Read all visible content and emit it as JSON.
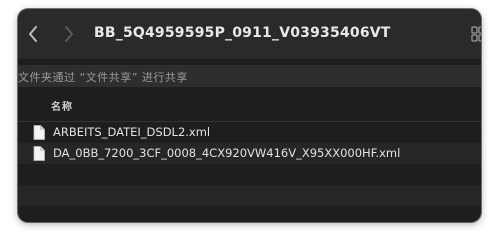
{
  "window": {
    "title": "BB_5Q4959595P_0911_V03935406VT",
    "share_text": "文件夹通过 “文件共享” 进行共享"
  },
  "header": {
    "name_label": "名称"
  },
  "files": [
    {
      "name": "ARBEITS_DATEI_DSDL2.xml",
      "icon": "document-icon"
    },
    {
      "name": "DA_0BB_7200_3CF_0008_4CX920VW416V_X95XX000HF.xml",
      "icon": "document-icon"
    }
  ],
  "colors": {
    "window_bg": "#1e1e1e",
    "toolbar_bg": "#2a2a2a",
    "text": "#e2e2e2",
    "muted_text": "#9a9a9a"
  }
}
